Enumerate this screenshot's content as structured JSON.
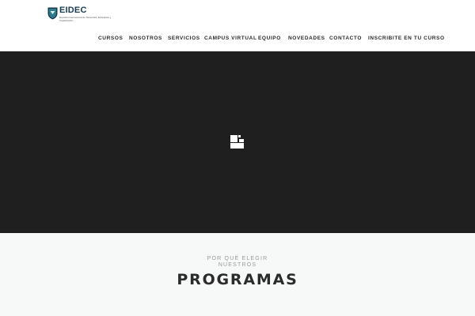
{
  "brand": {
    "name": "EIDEC",
    "tagline": "Escuela Internacional de Desarrollo, Educación y Capacitación",
    "colors": {
      "primary": "#1a3a52",
      "accent": "#2e7d8c"
    }
  },
  "nav": {
    "items": [
      {
        "label": "CURSOS"
      },
      {
        "label": "NOSOTROS"
      },
      {
        "label": "SERVICIOS"
      },
      {
        "label": "CAMPUS VIRTUAL"
      },
      {
        "label": "EQUIPO"
      },
      {
        "label": "NOVEDADES"
      },
      {
        "label": "CONTACTO"
      },
      {
        "label": "INSCRIBITE EN TU CURSO"
      }
    ]
  },
  "hero": {
    "background": "#1f1f1f",
    "loader_icon": "loading-squares-icon"
  },
  "programs": {
    "subtitle_line1": "POR QUÉ ELEGIR",
    "subtitle_line2": "NUESTROS",
    "title": "PROGRAMAS"
  }
}
